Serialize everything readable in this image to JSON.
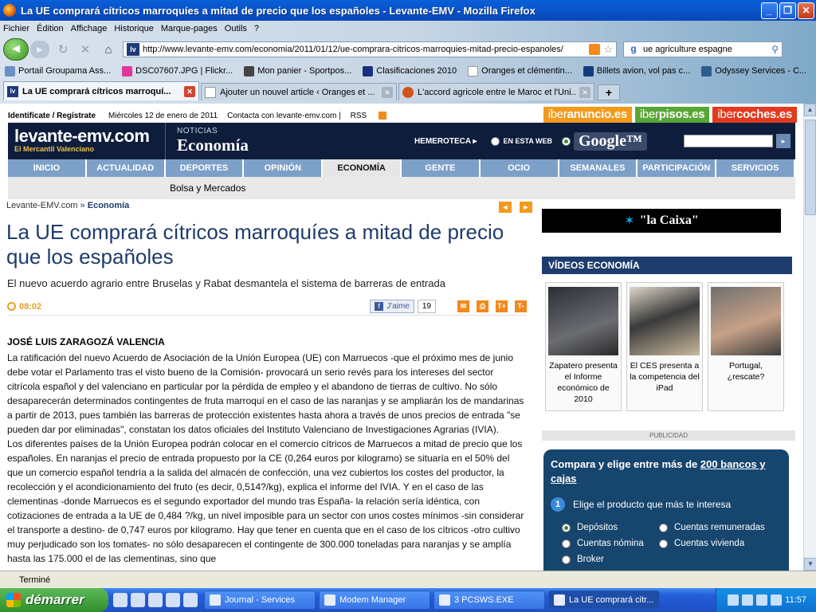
{
  "window": {
    "title": "La UE comprará cítricos marroquíes a mitad de precio que los españoles - Levante-EMV - Mozilla Firefox"
  },
  "menu": [
    "Fichier",
    "Édition",
    "Affichage",
    "Historique",
    "Marque-pages",
    "Outils",
    "?"
  ],
  "nav": {
    "url": "http://www.levante-emv.com/economia/2011/01/12/ue-comprara-citricos-marroquies-mitad-precio-espanoles/",
    "favicon": "lv",
    "search_engine": "g",
    "search_value": "ue agriculture espagne"
  },
  "bookmarks": [
    "Portail Groupama Ass...",
    "DSC07607.JPG | Flickr...",
    "Mon panier - Sportpos...",
    "Clasificaciones 2010",
    "Oranges et clémentin...",
    "Billets avion, vol pas c...",
    "Odyssey Services - C..."
  ],
  "tabs": [
    {
      "label": "La UE comprará cítricos marroquí...",
      "active": true
    },
    {
      "label": "Ajouter un nouvel article ‹ Oranges et ...",
      "active": false
    },
    {
      "label": "L'accord agricole entre le Maroc et l'Uni...",
      "active": false
    }
  ],
  "page": {
    "top_login": "Identifícate / Regístrate",
    "top_date": "Miércoles 12 de enero de 2011",
    "top_contact": "Contacta con levante-emv.com |",
    "top_rss": "RSS",
    "iber": [
      {
        "a": "iber",
        "b": "anuncio.es",
        "color": "#f39a1c"
      },
      {
        "a": "iber",
        "b": "pisos.es",
        "color": "#58a635"
      },
      {
        "a": "iber",
        "b": "coches.es",
        "color": "#e2391f"
      }
    ],
    "logo_main": "levante-emv.com",
    "logo_sub": "El Mercantil Valenciano",
    "section_kicker": "NOTICIAS",
    "section_name": "Economía",
    "hemeroteca": "HEMEROTECA ▸",
    "en_esta_web": "EN ESTA WEB",
    "google": "Google™",
    "search_button": "▸",
    "mainnav": [
      "INICIO",
      "ACTUALIDAD",
      "DEPORTES",
      "OPINIÓN",
      "ECONOMÍA",
      "GENTE",
      "OCIO",
      "SEMANALES",
      "PARTICIPACIÓN",
      "SERVICIOS"
    ],
    "mainnav_current": "ECONOMÍA",
    "subnav": "Bolsa y Mercados",
    "breadcrumb_home": "Levante-EMV.com",
    "breadcrumb_sep": "»",
    "breadcrumb_section": "Economía",
    "arrow_prev": "◄",
    "arrow_next": "►",
    "headline": "La UE comprará cítricos marroquíes a mitad de precio que los españoles",
    "subheadline": "El nuevo acuerdo agrario entre Bruselas y Rabat desmantela el sistema de barreras de entrada",
    "time": "08:02",
    "fb_label": "J'aime",
    "fb_glyph": "f",
    "fb_count": "19",
    "tools": [
      "✉",
      "⎙",
      "T+",
      "T-"
    ],
    "author": "JOSÉ LUIS ZARAGOZÁ VALENCIA",
    "paragraphs": [
      "La ratificación del nuevo Acuerdo de Asociación de la Unión Europea (UE) con Marruecos -que el próximo mes de junio debe votar el Parlamento tras el visto bueno de la Comisión- provocará un serio revés para los intereses del sector citrícola español y del valenciano en particular por la pérdida de empleo y el abandono de tierras de cultivo. No sólo desaparecerán determinados contingentes de fruta marroquí en el caso de las naranjas y se ampliarán los de mandarinas a partir de 2013, pues también las barreras de protección existentes hasta ahora a través de unos precios de entrada \"se pueden dar por eliminadas\", constatan los datos oficiales del Instituto Valenciano de Investigaciones Agrarias (IVIA).",
      "Los diferentes países de la Unión Europea podrán colocar en el comercio cítricos de Marruecos a mitad de precio que los españoles. En naranjas el precio de entrada propuesto por la CE (0,264 euros por kilogramo) se situaría en el 50% del que un comercio español tendría a la salida del almacén de confección, una vez cubiertos los costes del productor, la recolección y el acondicionamiento del fruto (es decir, 0,514?/kg), explica el informe del IVIA. Y en el caso de las clementinas -donde Marruecos es el segundo exportador del mundo tras España- la relación sería idéntica, con cotizaciones de entrada a la UE de 0,484 ?/kg, un nivel imposible para un sector con unos costes mínimos -sin considerar el transporte a destino- de 0,747 euros por kilogramo. Hay que tener en cuenta que en el caso de los cítricos -otro cultivo muy perjudicado son los tomates- no sólo desaparecen el contingente de 300.000 toneladas para naranjas y se amplía hasta las 175.000 el de las clementinas, sino que"
    ],
    "ad_caixa_star": "✶",
    "ad_caixa": "\"la Caixa\"",
    "videos_title": "VÍDEOS ECONOMÍA",
    "videos": [
      {
        "caption": "Zapatero presenta el Informe económico de 2010"
      },
      {
        "caption": "El CES presenta a la competencia del iPad"
      },
      {
        "caption": "Portugal, ¿rescate?"
      }
    ],
    "publicidad": "PUBLICIDAD",
    "bank_pre": "Compara y elige entre más de ",
    "bank_link": "200 bancos y cajas",
    "bank_step_num": "1",
    "bank_step": "Elige el producto que más te interesa",
    "bank_options": [
      "Depósitos",
      "Cuentas remuneradas",
      "Cuentas nómina",
      "Cuentas vivienda",
      "Broker"
    ],
    "bank_selected": "Depósitos"
  },
  "status": "Terminé",
  "taskbar": {
    "start": "démarrer",
    "tasks": [
      {
        "label": "Journal - Services",
        "active": false
      },
      {
        "label": "Modem Manager",
        "active": false
      },
      {
        "label": "3 PCSWS.EXE",
        "active": false
      },
      {
        "label": "La UE comprará citr...",
        "active": true
      }
    ],
    "clock": "11:57"
  }
}
